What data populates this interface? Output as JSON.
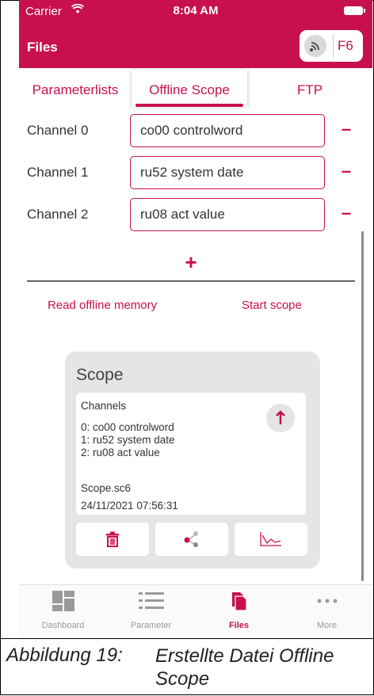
{
  "colors": {
    "accent": "#c8104e",
    "header_bg": "#c8104e"
  },
  "status_bar": {
    "carrier": "Carrier",
    "time": "8:04 AM"
  },
  "header": {
    "title": "Files",
    "device_label": "F6",
    "wireless_icon": "wifi-signal-icon"
  },
  "tabs": [
    {
      "label": "Parameterlists"
    },
    {
      "label": "Offline Scope",
      "selected": true
    },
    {
      "label": "FTP"
    }
  ],
  "channels": [
    {
      "label": "Channel 0",
      "value": "co00 controlword",
      "remove": "–"
    },
    {
      "label": "Channel 1",
      "value": "ru52 system date",
      "remove": "–"
    },
    {
      "label": "Channel 2",
      "value": "ru08 act value",
      "remove": "–"
    }
  ],
  "add_channel": "+",
  "actions": {
    "read": "Read offline memory",
    "start": "Start scope"
  },
  "scope_file": {
    "title": "Scope",
    "channels_heading": "Channels",
    "channels": [
      "0: co00 controlword",
      "1: ru52 system date",
      "2: ru08 act value"
    ],
    "filename": "Scope.sc6",
    "timestamp": "24/11/2021 07:56:31",
    "upload_icon": "arrow-up-icon",
    "action_icons": [
      "trash-icon",
      "share-icon",
      "chart-icon"
    ]
  },
  "tabbar": [
    {
      "label": "Dashboard",
      "icon": "dashboard-icon"
    },
    {
      "label": "Parameter",
      "icon": "list-icon"
    },
    {
      "label": "Files",
      "icon": "files-icon",
      "active": true
    },
    {
      "label": "More",
      "icon": "more-icon"
    }
  ],
  "caption": {
    "label": "Abbildung 19:",
    "text": "Erstellte Datei Offline Scope"
  }
}
